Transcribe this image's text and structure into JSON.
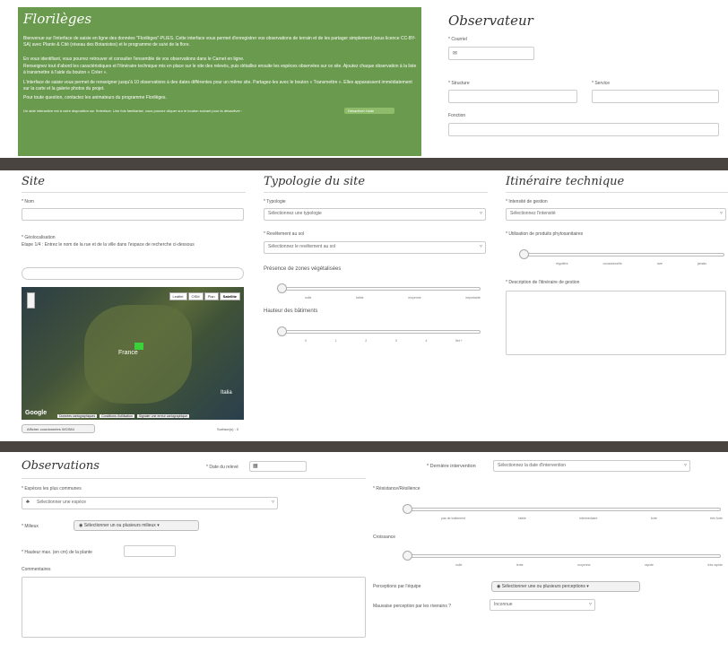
{
  "florileges": {
    "title": "Florilèges",
    "intro": "Bienvenue sur l'interface de saisie en ligne des données \"Florilèges\"-PLIES. Cette interface vous permet d'enregistrer vos observations de terrain et de les partager simplement (sous licence CC-BY-SA) avec Plante & Cité (réseau des Botanistes) et le programme de suivi de la flore.",
    "p2a": "En vous identifiant, vous pourrez retrouver et consulter l'ensemble de vos observations dans le Carnet en ligne.",
    "p2b": "Renseignez tout d'abord les caractéristiques et l'itinéraire technique mis en place sur le site des relevés, puis détaillez ensuite les espèces observées sur ce site. Ajoutez chaque observation à la liste à transmettre à l'aide du bouton « Créer ».",
    "p3": "L'interface de saisie vous permet de renseigner jusqu'à 10 observations à des dates différentes pour un même site. Partagez-les avec le bouton « Transmettre ». Elles apparaissent immédiatement sur la carte et la galerie photos du projet.",
    "p4": "Pour toute question, contactez les animateurs du programme Florilèges.",
    "tutorial": "Un aide interactive est à votre disposition sur l'interface. Une fois familiarisé, vous pouvez cliquer sur le bouton suivant pour la désactiver :",
    "tutorial_btn": "Désactiver l'aide"
  },
  "observateur": {
    "title": "Observateur",
    "courriel_label": "* Courriel",
    "structure_label": "* Structure",
    "service_label": "* Service",
    "fonction_label": "Fonction"
  },
  "site": {
    "title": "Site",
    "nom_label": "* Nom",
    "geoloc_label": "* Géolocalisation",
    "geoloc_hint": "Etape 1/4 : Entrez le nom de la rue et de la ville dans l'espace de recherche ci-dessous",
    "map_tabs": [
      "Leaflet",
      "OSM",
      "Plan",
      "Satellite"
    ],
    "map_label_france": "France",
    "map_label_italia": "Italia",
    "map_footer": [
      "Données cartographiques",
      "Conditions d'utilisation",
      "Signaler une erreur cartographique"
    ],
    "google": "Google",
    "coords_btn": "Afficher coordonnées WGS84",
    "surface": "Surface(s) : 0"
  },
  "typologie": {
    "title": "Typologie du site",
    "typologie_label": "* Typologie",
    "typologie_value": "Sélectionnez une typologie",
    "revetement_label": "* Revêtement au sol",
    "revetement_value": "Sélectionnez le revêtement au sol",
    "zones_label": "Présence de zones végétalisées",
    "zones_ticks": [
      "nulle",
      "faible",
      "moyenne",
      "importante"
    ],
    "zones_level": 0,
    "hauteur_label": "Hauteur des bâtiments",
    "hauteur_ticks": [
      "0",
      "1",
      "2",
      "3",
      "4",
      "5et +"
    ],
    "hauteur_level": 0
  },
  "itineraire": {
    "title": "Itinéraire technique",
    "intensite_label": "* Intensité de gestion",
    "intensite_value": "Sélectionnez l'intensité",
    "phyto_label": "* Utilisation de produits phytosanitaires",
    "phyto_ticks": [
      "régulière",
      "occasionnelle",
      "rare",
      "jamais"
    ],
    "phyto_level": 0,
    "description_label": "* Description de l'itinéraire de gestion"
  },
  "observations": {
    "title": "Observations",
    "date_label": "* Date du relevé",
    "derniere_label": "* Dernière intervention",
    "derniere_value": "Sélectionnez la date d'intervention",
    "especes_label": "* Espèces les plus communes",
    "especes_value": "Sélectionner une espèce",
    "milieux_label": "* Milieux",
    "milieux_btn": "Sélectionner un ou plusieurs milieux",
    "hauteur_label": "* Hauteur max. (en cm) de la plante",
    "commentaires_label": "Commentaires",
    "resistance_label": "* Résistance/Résilience",
    "resistance_ticks": [
      "pas de traitement",
      "faible",
      "intermédiaire",
      "forte",
      "très forte"
    ],
    "resistance_level": 0,
    "croissance_label": "Croissance",
    "croissance_ticks": [
      "nulle",
      "lente",
      "moyenne",
      "rapide",
      "très rapide"
    ],
    "croissance_level": 0,
    "perceptions_label": "Perceptions par l'équipe",
    "perceptions_btn": "Sélectionner une ou plusieurs perceptions",
    "mauvaise_label": "Mauvaise perception par les riverains ?",
    "mauvaise_value": "Inconnue"
  }
}
